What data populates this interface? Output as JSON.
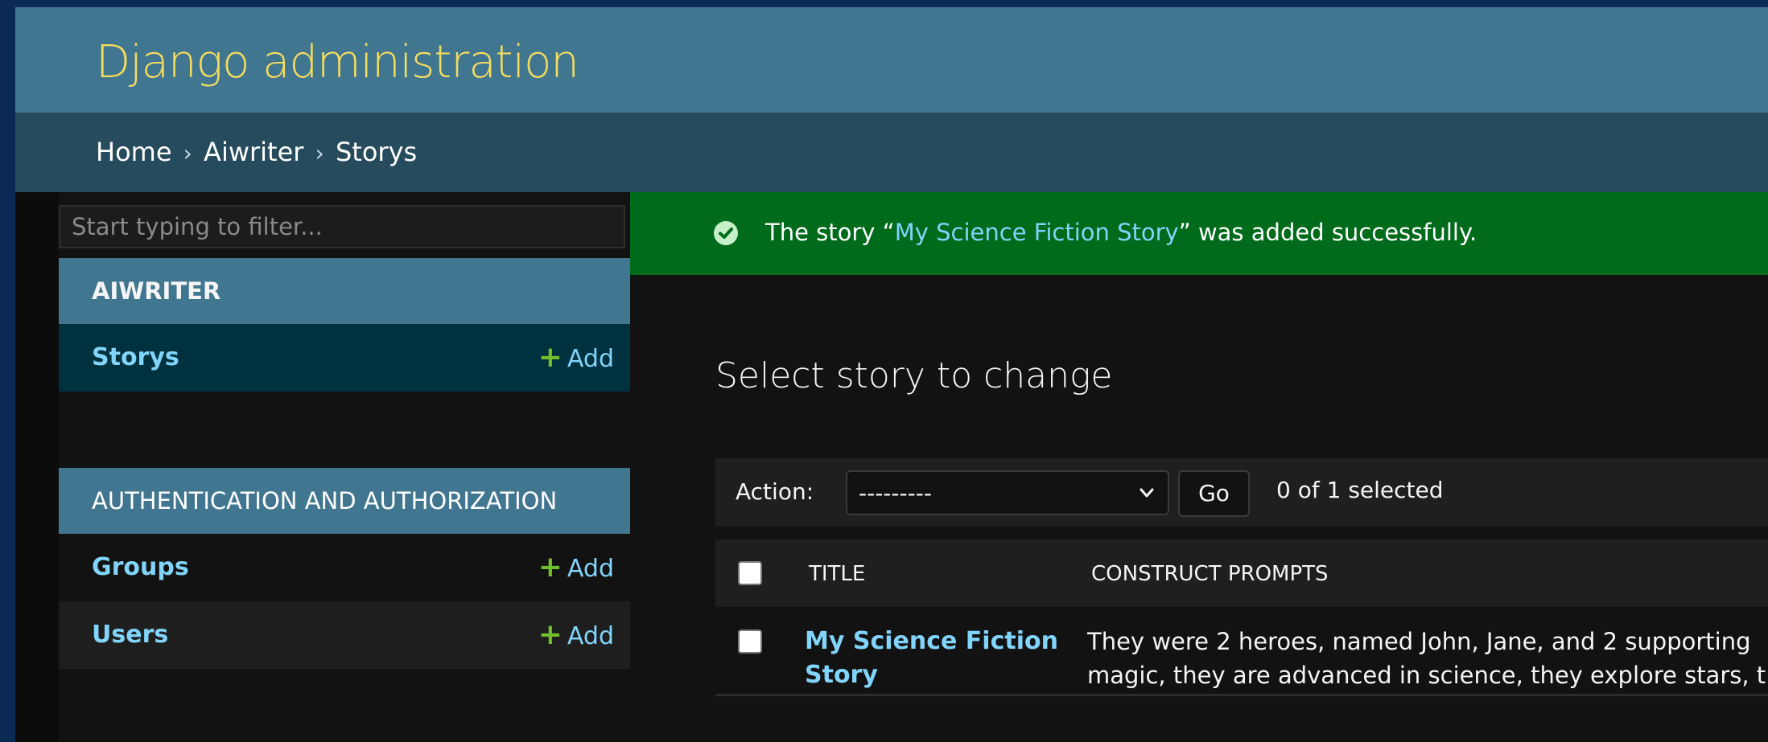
{
  "header": {
    "branding": "Django administration"
  },
  "breadcrumbs": {
    "items": [
      "Home",
      "Aiwriter",
      "Storys"
    ],
    "separator": "›"
  },
  "sidebar": {
    "filter_placeholder": "Start typing to filter...",
    "apps": [
      {
        "caption": "AIWRITER",
        "models": [
          {
            "name": "Storys",
            "add_label": "Add"
          }
        ]
      },
      {
        "caption": "AUTHENTICATION AND AUTHORIZATION",
        "models": [
          {
            "name": "Groups",
            "add_label": "Add"
          },
          {
            "name": "Users",
            "add_label": "Add"
          }
        ]
      }
    ]
  },
  "message": {
    "prefix": "The story “",
    "link": "My Science Fiction Story",
    "suffix": "” was added successfully."
  },
  "content": {
    "title": "Select story to change",
    "actions": {
      "label": "Action:",
      "selected_option": "---------",
      "go_label": "Go",
      "counter": "0 of 1 selected"
    },
    "table": {
      "columns": [
        "TITLE",
        "CONSTRUCT PROMPTS"
      ],
      "rows": [
        {
          "title_line1": "My Science Fiction",
          "title_line2": "Story",
          "prompts_line1": "They were 2 heroes, named John, Jane, and 2 supporting",
          "prompts_line2": "magic, they are advanced in science, they explore stars, t"
        }
      ]
    }
  },
  "colors": {
    "header_bg": "#417690",
    "branding": "#f5dd5d",
    "breadcrumbs_bg": "#264b5d",
    "link": "#81d4fa",
    "success_bg": "#006b1b",
    "add_plus": "#70bf2b"
  }
}
